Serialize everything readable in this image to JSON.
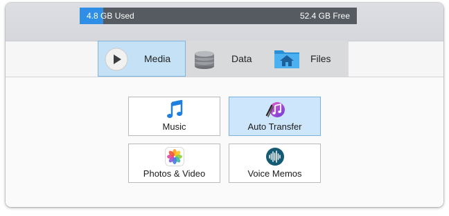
{
  "storage": {
    "used_label": "4.8 GB Used",
    "free_label": "52.4 GB Free",
    "used_fraction": 0.084
  },
  "tabs": [
    {
      "label": "Media",
      "icon": "play-icon",
      "active": true
    },
    {
      "label": "Data",
      "icon": "database-icon",
      "active": false
    },
    {
      "label": "Files",
      "icon": "folder-home-icon",
      "active": false
    }
  ],
  "cards": [
    {
      "label": "Music",
      "icon": "music-note-icon",
      "selected": false
    },
    {
      "label": "Auto Transfer",
      "icon": "auto-transfer-icon",
      "selected": true
    },
    {
      "label": "Photos & Video",
      "icon": "photos-flower-icon",
      "selected": false
    },
    {
      "label": "Voice Memos",
      "icon": "voice-memos-icon",
      "selected": false
    }
  ],
  "colors": {
    "accent": "#2f8fe6",
    "selected_bg": "#cde6fb",
    "tab_active_bg": "#c4e1f6"
  }
}
